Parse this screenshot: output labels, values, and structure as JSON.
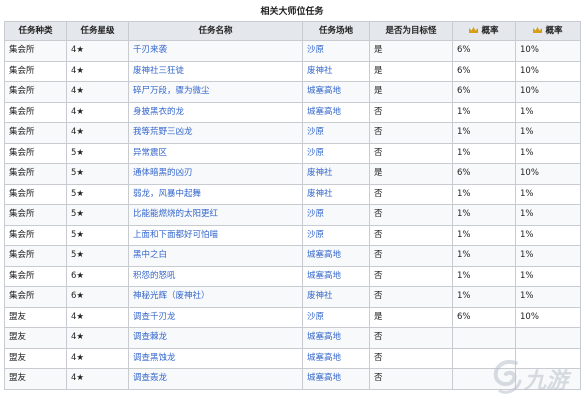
{
  "caption": "相关大师位任务",
  "headers": [
    "任务种类",
    "任务星级",
    "任务名称",
    "任务场地",
    "是否为目标怪",
    "概率",
    "概率"
  ],
  "rows": [
    {
      "type": "集会所",
      "star": "4★",
      "name": "千刃来袭",
      "place": "沙原",
      "target": "是",
      "p1": "6%",
      "p2": "10%"
    },
    {
      "type": "集会所",
      "star": "4★",
      "name": "废神社三狂徒",
      "place": "废神社",
      "target": "是",
      "p1": "6%",
      "p2": "10%"
    },
    {
      "type": "集会所",
      "star": "4★",
      "name": "碎尸万段，骤为微尘",
      "place": "城塞高地",
      "target": "是",
      "p1": "6%",
      "p2": "10%"
    },
    {
      "type": "集会所",
      "star": "4★",
      "name": "身披黑衣的龙",
      "place": "城塞高地",
      "target": "否",
      "p1": "1%",
      "p2": "1%"
    },
    {
      "type": "集会所",
      "star": "4★",
      "name": "我等荒野三凶龙",
      "place": "沙原",
      "target": "否",
      "p1": "1%",
      "p2": "1%"
    },
    {
      "type": "集会所",
      "star": "5★",
      "name": "异常震区",
      "place": "沙原",
      "target": "否",
      "p1": "1%",
      "p2": "1%"
    },
    {
      "type": "集会所",
      "star": "5★",
      "name": "通体暗黑的凶刃",
      "place": "废神社",
      "target": "是",
      "p1": "6%",
      "p2": "10%"
    },
    {
      "type": "集会所",
      "star": "5★",
      "name": "弱龙，风暴中起舞",
      "place": "废神社",
      "target": "否",
      "p1": "1%",
      "p2": "1%"
    },
    {
      "type": "集会所",
      "star": "5★",
      "name": "比能能燃烧的太阳更红",
      "place": "沙原",
      "target": "否",
      "p1": "1%",
      "p2": "1%"
    },
    {
      "type": "集会所",
      "star": "5★",
      "name": "上面和下面都好可怕喵",
      "place": "沙原",
      "target": "否",
      "p1": "1%",
      "p2": "1%"
    },
    {
      "type": "集会所",
      "star": "5★",
      "name": "黑中之白",
      "place": "城塞高地",
      "target": "否",
      "p1": "1%",
      "p2": "1%"
    },
    {
      "type": "集会所",
      "star": "6★",
      "name": "积怨的怒吼",
      "place": "城塞高地",
      "target": "否",
      "p1": "1%",
      "p2": "1%"
    },
    {
      "type": "集会所",
      "star": "6★",
      "name": "神秘光辉（废神社）",
      "place": "废神社",
      "target": "否",
      "p1": "1%",
      "p2": "1%"
    },
    {
      "type": "盟友",
      "star": "4★",
      "name": "调查千刃龙",
      "place": "沙原",
      "target": "是",
      "p1": "6%",
      "p2": "10%"
    },
    {
      "type": "盟友",
      "star": "4★",
      "name": "调查棘龙",
      "place": "城塞高地",
      "target": "否",
      "p1": "",
      "p2": ""
    },
    {
      "type": "盟友",
      "star": "4★",
      "name": "调查黑蚀龙",
      "place": "城塞高地",
      "target": "否",
      "p1": "",
      "p2": ""
    },
    {
      "type": "盟友",
      "star": "4★",
      "name": "调查轰龙",
      "place": "城塞高地",
      "target": "否",
      "p1": "",
      "p2": ""
    }
  ],
  "watermark": "九游",
  "colors": {
    "link": "#3366cc",
    "header_bg": "#e4e7eb",
    "crown": "#d4a017"
  }
}
